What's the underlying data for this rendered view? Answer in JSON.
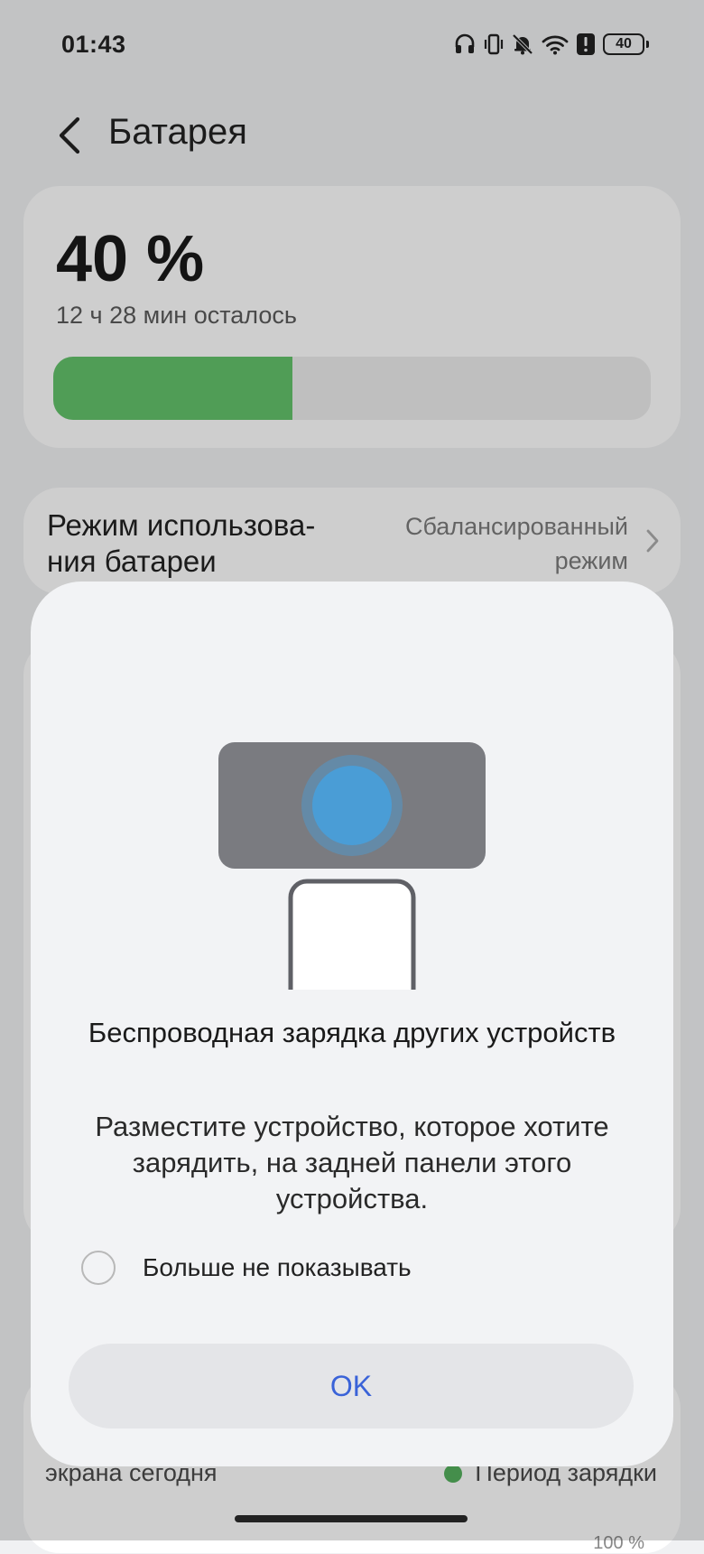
{
  "status_bar": {
    "time": "01:43",
    "battery_level": "40",
    "icons": [
      "headphones-icon",
      "vibrate-icon",
      "bell-muted-icon",
      "wifi-icon",
      "alert-icon",
      "battery-icon"
    ]
  },
  "header": {
    "title": "Батарея"
  },
  "battery_card": {
    "percent": "40 %",
    "remaining": "12 ч 28 мин осталось",
    "level_fraction": 0.4,
    "bar_color": "#5ec066"
  },
  "mode_row": {
    "label": "Режим использова-ния батареи",
    "value": "Сбалансированный режим"
  },
  "usage_card": {
    "label": "экрана сегодня",
    "legend": "Период зарядки",
    "legend_color": "#4fae58",
    "axis_max": "100 %"
  },
  "dialog": {
    "title": "Беспроводная зарядка других устройств",
    "message": "Разместите устройство, которое хотите зарядить, на задней панели этого устройства.",
    "checkbox_label": "Больше не показывать",
    "checkbox_checked": false,
    "ok_label": "OK",
    "accent_color": "#3a63d8"
  }
}
